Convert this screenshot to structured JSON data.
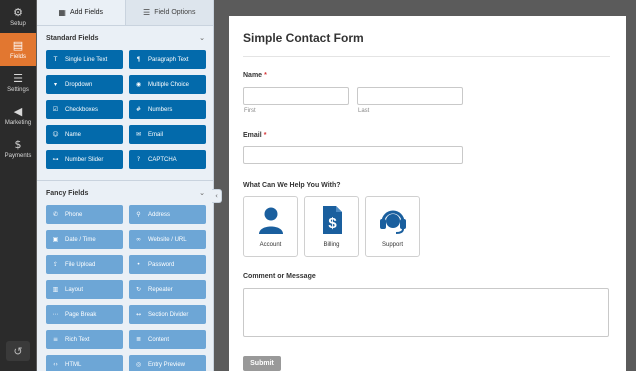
{
  "rail": {
    "items": [
      {
        "label": "Setup",
        "icon": "gear-icon"
      },
      {
        "label": "Fields",
        "icon": "fields-icon"
      },
      {
        "label": "Settings",
        "icon": "sliders-icon"
      },
      {
        "label": "Marketing",
        "icon": "megaphone-icon"
      },
      {
        "label": "Payments",
        "icon": "dollar-icon"
      }
    ],
    "active": "Fields",
    "bottom_icon": "history-icon"
  },
  "panel": {
    "tabs": [
      {
        "label": "Add Fields",
        "icon": "list-icon"
      },
      {
        "label": "Field Options",
        "icon": "sliders-icon"
      }
    ],
    "standard": {
      "title": "Standard Fields",
      "items": [
        {
          "label": "Single Line Text",
          "icon": "text-icon"
        },
        {
          "label": "Paragraph Text",
          "icon": "paragraph-icon"
        },
        {
          "label": "Dropdown",
          "icon": "dropdown-icon"
        },
        {
          "label": "Multiple Choice",
          "icon": "radio-icon"
        },
        {
          "label": "Checkboxes",
          "icon": "checkbox-icon"
        },
        {
          "label": "Numbers",
          "icon": "hash-icon"
        },
        {
          "label": "Name",
          "icon": "user-icon"
        },
        {
          "label": "Email",
          "icon": "envelope-icon"
        },
        {
          "label": "Number Slider",
          "icon": "slider-icon"
        },
        {
          "label": "CAPTCHA",
          "icon": "captcha-icon"
        }
      ]
    },
    "fancy": {
      "title": "Fancy Fields",
      "items": [
        {
          "label": "Phone",
          "icon": "phone-icon"
        },
        {
          "label": "Address",
          "icon": "map-pin-icon"
        },
        {
          "label": "Date / Time",
          "icon": "calendar-icon"
        },
        {
          "label": "Website / URL",
          "icon": "link-icon"
        },
        {
          "label": "File Upload",
          "icon": "upload-icon"
        },
        {
          "label": "Password",
          "icon": "lock-icon"
        },
        {
          "label": "Layout",
          "icon": "columns-icon"
        },
        {
          "label": "Repeater",
          "icon": "repeat-icon"
        },
        {
          "label": "Page Break",
          "icon": "page-break-icon"
        },
        {
          "label": "Section Divider",
          "icon": "divider-icon"
        },
        {
          "label": "Rich Text",
          "icon": "rich-text-icon"
        },
        {
          "label": "Content",
          "icon": "content-icon"
        },
        {
          "label": "HTML",
          "icon": "code-icon"
        },
        {
          "label": "Entry Preview",
          "icon": "eye-icon"
        }
      ]
    }
  },
  "form": {
    "title": "Simple Contact Form",
    "name_label": "Name",
    "name_first": "First",
    "name_last": "Last",
    "email_label": "Email",
    "required_mark": "*",
    "help_label": "What Can We Help You With?",
    "choices": [
      {
        "label": "Account",
        "icon": "user-icon"
      },
      {
        "label": "Billing",
        "icon": "invoice-dollar-icon"
      },
      {
        "label": "Support",
        "icon": "headset-icon"
      }
    ],
    "comment_label": "Comment or Message",
    "submit_label": "Submit"
  },
  "colors": {
    "accent": "#e27730",
    "standard_button": "#036aab",
    "fancy_button": "#6da6d6",
    "choice_icon": "#1a5f9e"
  }
}
